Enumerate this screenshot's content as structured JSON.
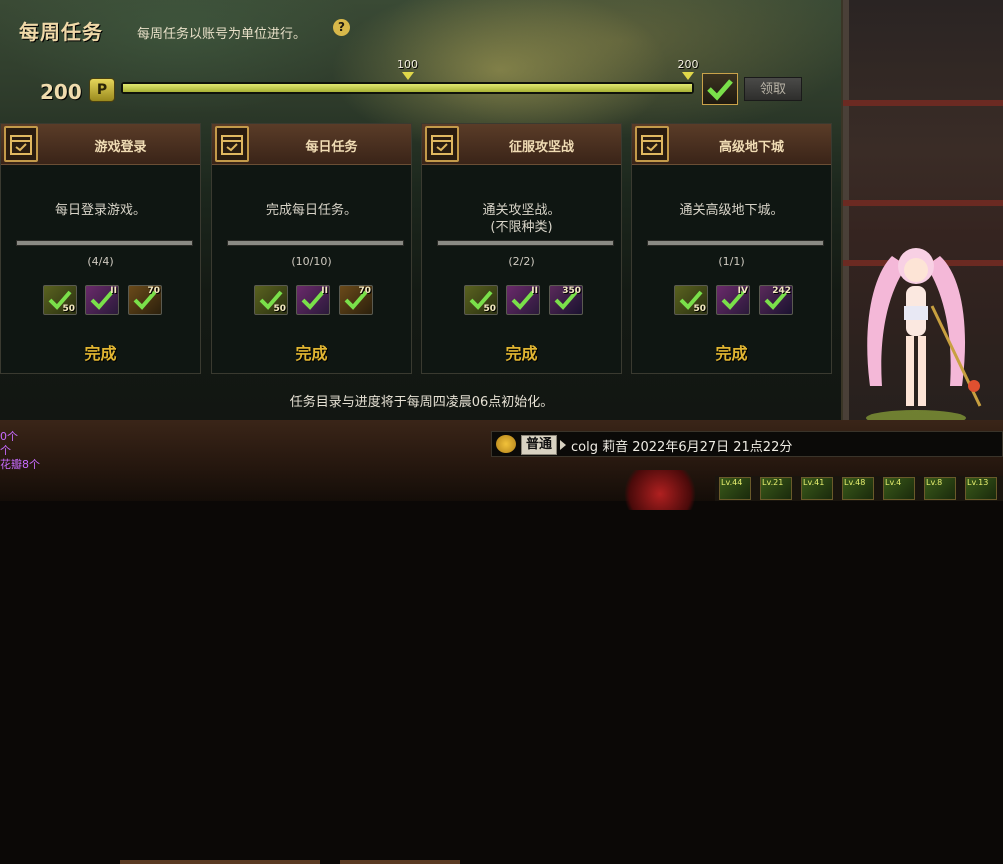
{
  "panel": {
    "title": "每周任务",
    "description": "每周任务以账号为单位进行。",
    "help_glyph": "?"
  },
  "points": {
    "value": "200",
    "badge": "P",
    "progress_fraction": 1.0,
    "markers": [
      {
        "label": "100",
        "fraction": 0.5
      },
      {
        "label": "200",
        "fraction": 1.0
      }
    ],
    "claim_label": "领取"
  },
  "tasks": [
    {
      "title": "游戏登录",
      "desc": "每日登录游戏。",
      "desc2": "",
      "progress": "(4/4)",
      "status": "完成",
      "rewards": [
        {
          "type": "a",
          "label": "50"
        },
        {
          "type": "b",
          "label": "II"
        },
        {
          "type": "c",
          "label": "70"
        }
      ]
    },
    {
      "title": "每日任务",
      "desc": "完成每日任务。",
      "desc2": "",
      "progress": "(10/10)",
      "status": "完成",
      "rewards": [
        {
          "type": "a",
          "label": "50"
        },
        {
          "type": "b",
          "label": "II"
        },
        {
          "type": "c",
          "label": "70"
        }
      ]
    },
    {
      "title": "征服攻坚战",
      "desc": "通关攻坚战。",
      "desc2": "(不限种类)",
      "progress": "(2/2)",
      "status": "完成",
      "rewards": [
        {
          "type": "a",
          "label": "50"
        },
        {
          "type": "b",
          "label": "II"
        },
        {
          "type": "d",
          "label": "350"
        }
      ]
    },
    {
      "title": "高级地下城",
      "desc": "通关高级地下城。",
      "desc2": "",
      "progress": "(1/1)",
      "status": "完成",
      "rewards": [
        {
          "type": "a",
          "label": "50"
        },
        {
          "type": "b",
          "label": "IV"
        },
        {
          "type": "d",
          "label": "242"
        }
      ]
    }
  ],
  "footer_note": "任务目录与进度将于每周四凌晨06点初始化。",
  "chat": {
    "channel": "普通",
    "message": "colg 莉音 2022年6月27日 21点22分"
  },
  "left_chat": [
    "0个",
    "个",
    "花瓣8个"
  ],
  "skills": [
    "Lv.44",
    "Lv.21",
    "Lv.41",
    "Lv.48",
    "Lv.4",
    "Lv.8",
    "Lv.13"
  ],
  "colors": {
    "accent": "#e2b632",
    "progress": "#d6df5a"
  }
}
